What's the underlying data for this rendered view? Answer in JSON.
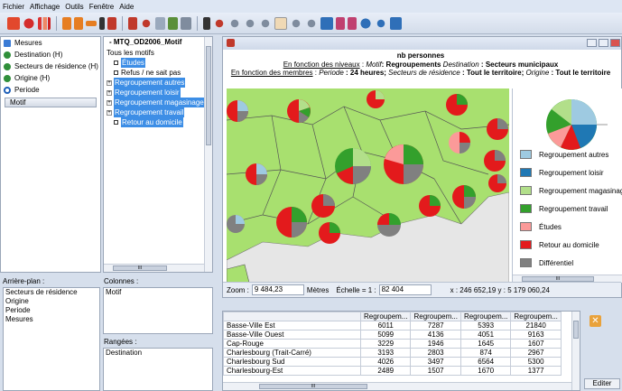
{
  "menu": [
    "Fichier",
    "Affichage",
    "Outils",
    "Fenêtre",
    "Aide"
  ],
  "toolbar_icons": [
    "cube-icon",
    "pie-chart-icon",
    "bar-chart-icon",
    "dimension-icon",
    "dimension2-icon",
    "arrow-dim-icon",
    "pointer-icon",
    "pin-icon",
    "layer-icon",
    "zoom-icon",
    "copy-icon",
    "paint-icon",
    "print-icon",
    "select-icon",
    "zoom-in-icon",
    "zoom-out-icon",
    "zoom-window-icon",
    "zoom-prev-icon",
    "hand-icon",
    "zoom-all-icon",
    "zoom-layer-icon",
    "map-icon",
    "measure-icon",
    "style-icon",
    "info-icon",
    "search-icon",
    "binoculars-icon"
  ],
  "left": {
    "items": [
      {
        "label": "Mesures",
        "icon": "grid-icon",
        "color": "#3a7bd5"
      },
      {
        "label": "Destination (H)",
        "icon": "globe-icon",
        "color": "#2f8f3a"
      },
      {
        "label": "Secteurs de résidence (H)",
        "icon": "globe-icon",
        "color": "#2f8f3a"
      },
      {
        "label": "Origine (H)",
        "icon": "globe-icon",
        "color": "#2f8f3a"
      },
      {
        "label": "Periode",
        "icon": "clock-icon",
        "color": "#1e5fb8"
      }
    ],
    "motif_button": "Motif"
  },
  "tree": {
    "title": "MTQ_OD2006_Motif",
    "root": "Tous les motifs",
    "items": [
      {
        "label": "Études",
        "selected": true,
        "expandable": false
      },
      {
        "label": "Refus / ne sait pas",
        "selected": false,
        "expandable": false
      },
      {
        "label": "Regroupement autres",
        "selected": true,
        "expandable": true
      },
      {
        "label": "Regroupement loisir",
        "selected": true,
        "expandable": true
      },
      {
        "label": "Regroupement magasinage",
        "selected": true,
        "expandable": true
      },
      {
        "label": "Regroupement travail",
        "selected": true,
        "expandable": true
      },
      {
        "label": "Retour au domicile",
        "selected": true,
        "expandable": false
      }
    ],
    "scroll_label": "III"
  },
  "bottom_left": {
    "arriere_plan_label": "Arrière-plan :",
    "arriere_plan": [
      "Secteurs de résidence",
      "Origine",
      "Periode",
      "Mesures"
    ],
    "colonnes_label": "Colonnes :",
    "colonnes": [
      "Motif"
    ],
    "rangees_label": "Rangées :",
    "rangees": [
      "Destination"
    ]
  },
  "map": {
    "title": "nb personnes",
    "line1_prefix": "En fonction des niveaux",
    "line1_a": " : ",
    "line1_motif_label": "Motif",
    "line1_motif_value": ": Regroupements ",
    "line1_dest_label": "Destination",
    "line1_dest_value": " : Secteurs municipaux",
    "line2_prefix": "En fonction des membres",
    "line2_rest_a": " : ",
    "line2_periode_label": "Periode",
    "line2_periode_value": " : 24 heures; ",
    "line2_secteurs_label": "Secteurs de résidence",
    "line2_secteurs_value": " : Tout le territoire; ",
    "line2_origine_label": "Origine",
    "line2_origine_value": " : Tout le territoire",
    "legend": [
      {
        "label": "Regroupement autres",
        "color": "#9ecae1"
      },
      {
        "label": "Regroupement loisir",
        "color": "#1f78b4"
      },
      {
        "label": "Regroupement magasinage",
        "color": "#b2df8a"
      },
      {
        "label": "Regroupement travail",
        "color": "#33a02c"
      },
      {
        "label": "Études",
        "color": "#fb9a99"
      },
      {
        "label": "Retour au domicile",
        "color": "#e31a1c"
      },
      {
        "label": "Différentiel",
        "color": "#808080"
      }
    ],
    "legend_scroll": "III",
    "status": {
      "zoom_label": "Zoom :",
      "zoom_value": "9 484,23",
      "units": "Mètres",
      "scale_label": "Échelle = 1 :",
      "scale_value": "82 404",
      "coords": "x : 246 652,19  y : 5 179 060,24"
    }
  },
  "table": {
    "headers": [
      "",
      "Regroupem...",
      "Regroupem...",
      "Regroupem...",
      "Regroupem..."
    ],
    "rows": [
      [
        "Basse-Ville Est",
        "6011",
        "7287",
        "5393",
        "21840"
      ],
      [
        "Basse-Ville Ouest",
        "5099",
        "4136",
        "4051",
        "9163"
      ],
      [
        "Cap-Rouge",
        "3229",
        "1946",
        "1645",
        "1607"
      ],
      [
        "Charlesbourg (Trait-Carré)",
        "3193",
        "2803",
        "874",
        "2967"
      ],
      [
        "Charlesbourg Sud",
        "4026",
        "3497",
        "6564",
        "5300"
      ],
      [
        "Charlesbourg-Est",
        "2489",
        "1507",
        "1670",
        "1377"
      ]
    ],
    "scroll_label": "III"
  },
  "right": {
    "close": "✕",
    "edit_button": "Editer"
  }
}
